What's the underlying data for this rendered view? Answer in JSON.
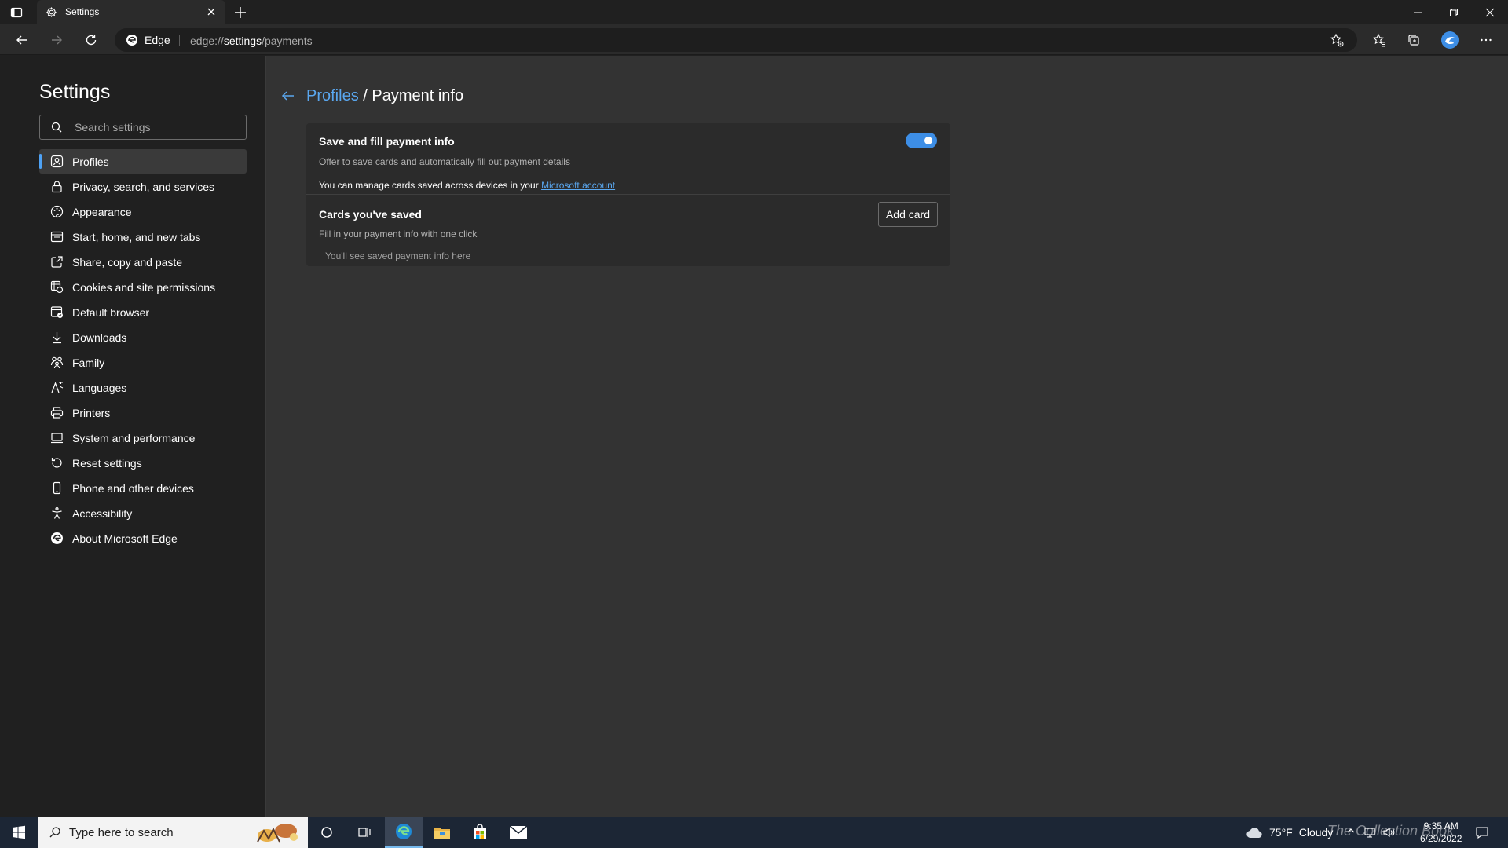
{
  "window": {
    "tab_title": "Settings"
  },
  "address_bar": {
    "browser_label": "Edge",
    "url_scheme": "edge://",
    "url_host": "settings",
    "url_path": "/payments"
  },
  "sidebar": {
    "title": "Settings",
    "search_placeholder": "Search settings",
    "items": [
      {
        "label": "Profiles",
        "icon": "profile-icon",
        "active": true
      },
      {
        "label": "Privacy, search, and services",
        "icon": "lock-icon"
      },
      {
        "label": "Appearance",
        "icon": "appearance-icon"
      },
      {
        "label": "Start, home, and new tabs",
        "icon": "home-tabs-icon"
      },
      {
        "label": "Share, copy and paste",
        "icon": "share-icon"
      },
      {
        "label": "Cookies and site permissions",
        "icon": "cookies-icon"
      },
      {
        "label": "Default browser",
        "icon": "default-browser-icon"
      },
      {
        "label": "Downloads",
        "icon": "download-icon"
      },
      {
        "label": "Family",
        "icon": "family-icon"
      },
      {
        "label": "Languages",
        "icon": "languages-icon"
      },
      {
        "label": "Printers",
        "icon": "printer-icon"
      },
      {
        "label": "System and performance",
        "icon": "system-icon"
      },
      {
        "label": "Reset settings",
        "icon": "reset-icon"
      },
      {
        "label": "Phone and other devices",
        "icon": "phone-icon"
      },
      {
        "label": "Accessibility",
        "icon": "accessibility-icon"
      },
      {
        "label": "About Microsoft Edge",
        "icon": "edge-logo-icon"
      }
    ]
  },
  "main": {
    "breadcrumb_parent": "Profiles",
    "breadcrumb_sep": " / ",
    "breadcrumb_current": "Payment info",
    "save_fill": {
      "title": "Save and fill payment info",
      "subtitle": "Offer to save cards and automatically fill out payment details",
      "manage_text": "You can manage cards saved across devices in your ",
      "manage_link": "Microsoft account",
      "toggle_on": true
    },
    "cards": {
      "title": "Cards you've saved",
      "subtitle": "Fill in your payment info with one click",
      "add_button": "Add card",
      "empty_text": "You'll see saved payment info here"
    }
  },
  "taskbar": {
    "search_placeholder": "Type here to search",
    "weather_temp": "75°F",
    "weather_condition": "Cloudy",
    "time": "9:35 AM",
    "date": "6/29/2022",
    "watermark": "The Collection Book"
  },
  "colors": {
    "accent": "#3d8ee6",
    "link": "#5aa7ef",
    "panel": "#2b2b2b",
    "background": "#333333",
    "sidebar": "#202020"
  }
}
